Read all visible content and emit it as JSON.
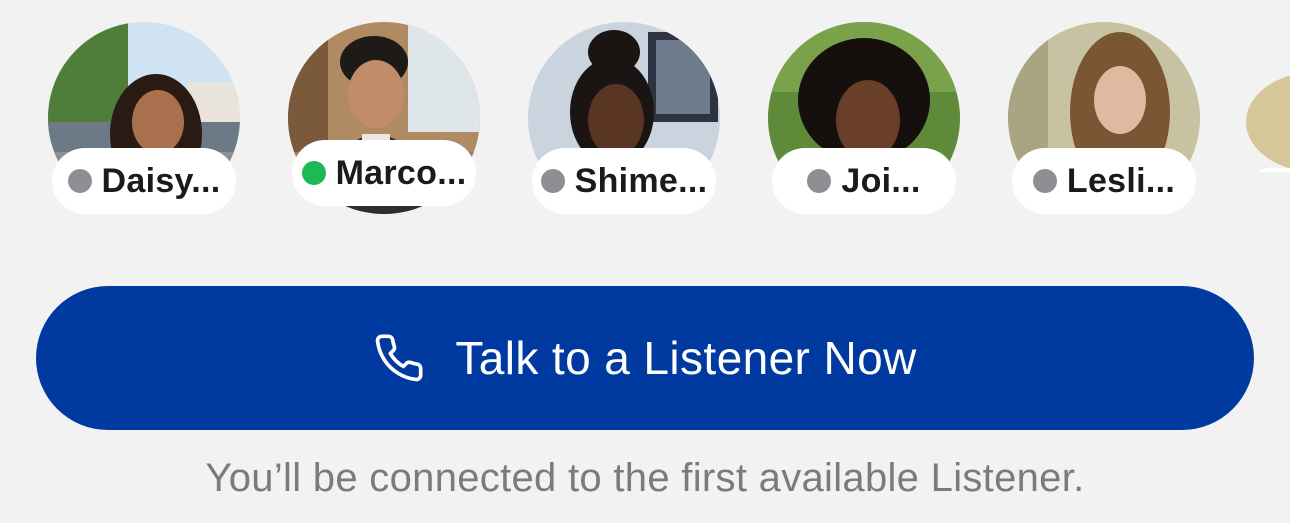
{
  "listeners": [
    {
      "name": "Daisy...",
      "status": "offline",
      "status_color": "#8e8e93",
      "photo": "woman-braids-outdoor"
    },
    {
      "name": "Marco...",
      "status": "online",
      "status_color": "#1db954",
      "photo": "man-smiling-indoor"
    },
    {
      "name": "Shime...",
      "status": "offline",
      "status_color": "#8e8e93",
      "photo": "woman-bun-indoor"
    },
    {
      "name": "Joi...",
      "status": "offline",
      "status_color": "#8e8e93",
      "photo": "woman-curly-garden"
    },
    {
      "name": "Lesli...",
      "status": "offline",
      "status_color": "#8e8e93",
      "photo": "woman-long-hair-room"
    }
  ],
  "cta": {
    "label": "Talk to a Listener Now",
    "icon": "phone-icon",
    "color": "#003aa0"
  },
  "caption": "You’ll be connected to the first available Listener."
}
